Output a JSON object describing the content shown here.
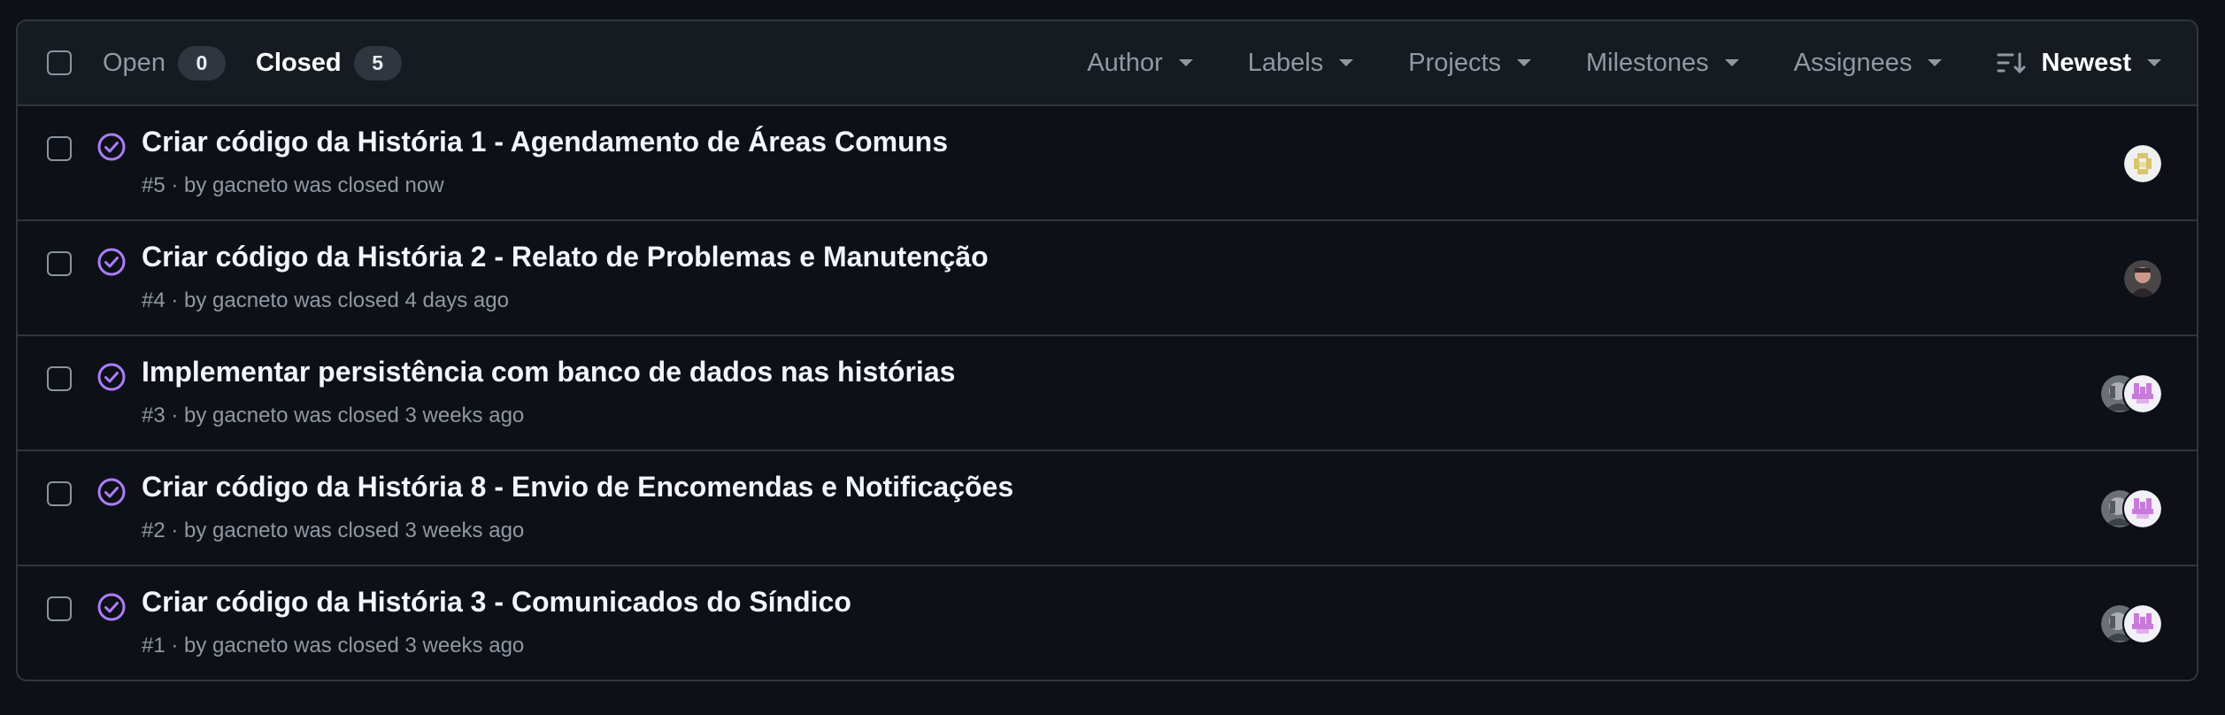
{
  "states": {
    "open": {
      "label": "Open",
      "count": "0"
    },
    "closed": {
      "label": "Closed",
      "count": "5"
    }
  },
  "filters": [
    "Author",
    "Labels",
    "Projects",
    "Milestones",
    "Assignees"
  ],
  "sort": {
    "label": "Newest",
    "icon": "sort-desc-icon"
  },
  "issues": [
    {
      "title": "Criar código da História 1 - Agendamento de Áreas Comuns",
      "meta": "#5 · by gacneto was closed now",
      "assignees": [
        "avatar-yellow-identicon"
      ]
    },
    {
      "title": "Criar código da História 2 - Relato de Problemas e Manutenção",
      "meta": "#4 · by gacneto was closed 4 days ago",
      "assignees": [
        "avatar-photo"
      ]
    },
    {
      "title": "Implementar persistência com banco de dados nas histórias",
      "meta": "#3 · by gacneto was closed 3 weeks ago",
      "assignees": [
        "avatar-purple-identicon",
        "avatar-grey-photo"
      ]
    },
    {
      "title": "Criar código da História 8 - Envio de Encomendas e Notificações",
      "meta": "#2 · by gacneto was closed 3 weeks ago",
      "assignees": [
        "avatar-purple-identicon",
        "avatar-grey-photo"
      ]
    },
    {
      "title": "Criar código da História 3 - Comunicados do Síndico",
      "meta": "#1 · by gacneto was closed 3 weeks ago",
      "assignees": [
        "avatar-purple-identicon",
        "avatar-grey-photo"
      ]
    }
  ],
  "colors": {
    "background": "#0d1117",
    "header": "#161b22",
    "border": "#30363d",
    "closed_status": "#ab7df8",
    "muted_text": "#9198a1"
  }
}
